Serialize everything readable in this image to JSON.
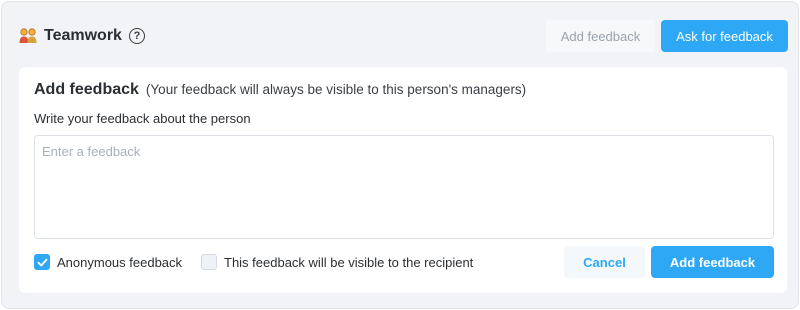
{
  "header": {
    "icon": "team-people-icon",
    "title": "Teamwork",
    "help_icon": "question-circle-icon",
    "help_glyph": "?"
  },
  "toolbar": {
    "add_feedback_label": "Add feedback",
    "ask_feedback_label": "Ask for feedback"
  },
  "form": {
    "title": "Add feedback",
    "note": "(Your feedback will always be visible to this person's managers)",
    "field_label": "Write your feedback about the person",
    "textarea_value": "",
    "textarea_placeholder": "Enter a feedback",
    "options": [
      {
        "label": "Anonymous feedback",
        "checked": true
      },
      {
        "label": "This feedback will be visible to the recipient",
        "checked": false
      }
    ],
    "cancel_label": "Cancel",
    "submit_label": "Add feedback"
  },
  "colors": {
    "accent": "#2ea8f5",
    "panel_bg": "#f1f3f6",
    "disabled_text": "#9aa3ad"
  }
}
